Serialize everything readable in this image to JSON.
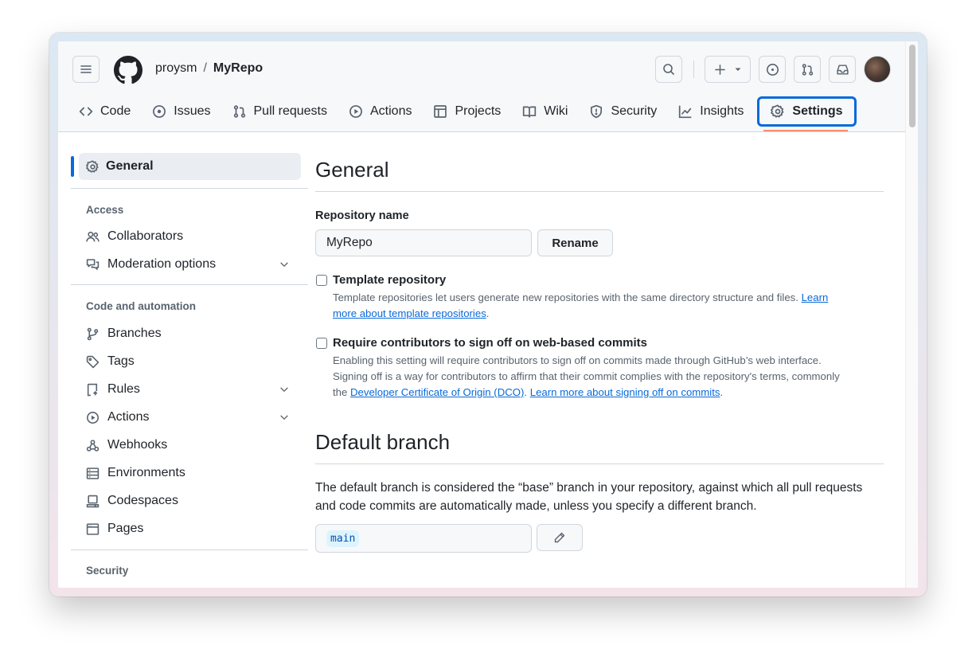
{
  "header": {
    "owner": "proysm",
    "separator": "/",
    "repo": "MyRepo"
  },
  "tabs": [
    {
      "label": "Code",
      "icon": "code-icon"
    },
    {
      "label": "Issues",
      "icon": "issue-opened-icon"
    },
    {
      "label": "Pull requests",
      "icon": "git-pull-request-icon"
    },
    {
      "label": "Actions",
      "icon": "play-icon"
    },
    {
      "label": "Projects",
      "icon": "table-icon"
    },
    {
      "label": "Wiki",
      "icon": "book-icon"
    },
    {
      "label": "Security",
      "icon": "shield-icon"
    },
    {
      "label": "Insights",
      "icon": "graph-icon"
    },
    {
      "label": "Settings",
      "icon": "gear-icon",
      "selected": true
    }
  ],
  "sidebar": {
    "general": "General",
    "access_heading": "Access",
    "collaborators": "Collaborators",
    "moderation": "Moderation options",
    "code_heading": "Code and automation",
    "branches": "Branches",
    "tags": "Tags",
    "rules": "Rules",
    "actions": "Actions",
    "webhooks": "Webhooks",
    "environments": "Environments",
    "codespaces": "Codespaces",
    "pages": "Pages",
    "security_heading": "Security"
  },
  "main": {
    "title": "General",
    "repo_name_label": "Repository name",
    "repo_name_value": "MyRepo",
    "rename_button": "Rename",
    "template": {
      "title": "Template repository",
      "desc": "Template repositories let users generate new repositories with the same directory structure and files. ",
      "link1": "Learn",
      "link2": "more about template repositories",
      "end": "."
    },
    "signoff": {
      "title": "Require contributors to sign off on web-based commits",
      "desc1": "Enabling this setting will require contributors to sign off on commits made through GitHub’s web interface.",
      "desc2": "Signing off is a way for contributors to affirm that their commit complies with the repository's terms, commonly",
      "desc3_pre": "the ",
      "link_dco": "Developer Certificate of Origin (DCO)",
      "mid": ". ",
      "link_learn": "Learn more about signing off on commits",
      "end": "."
    },
    "default_branch_title": "Default branch",
    "default_branch_desc": "The default branch is considered the “base” branch in your repository, against which all pull requests and code commits are automatically made, unless you specify a different branch.",
    "default_branch_value": "main"
  },
  "colors": {
    "accent": "#0969da",
    "selected_underline": "#fd8c73"
  }
}
